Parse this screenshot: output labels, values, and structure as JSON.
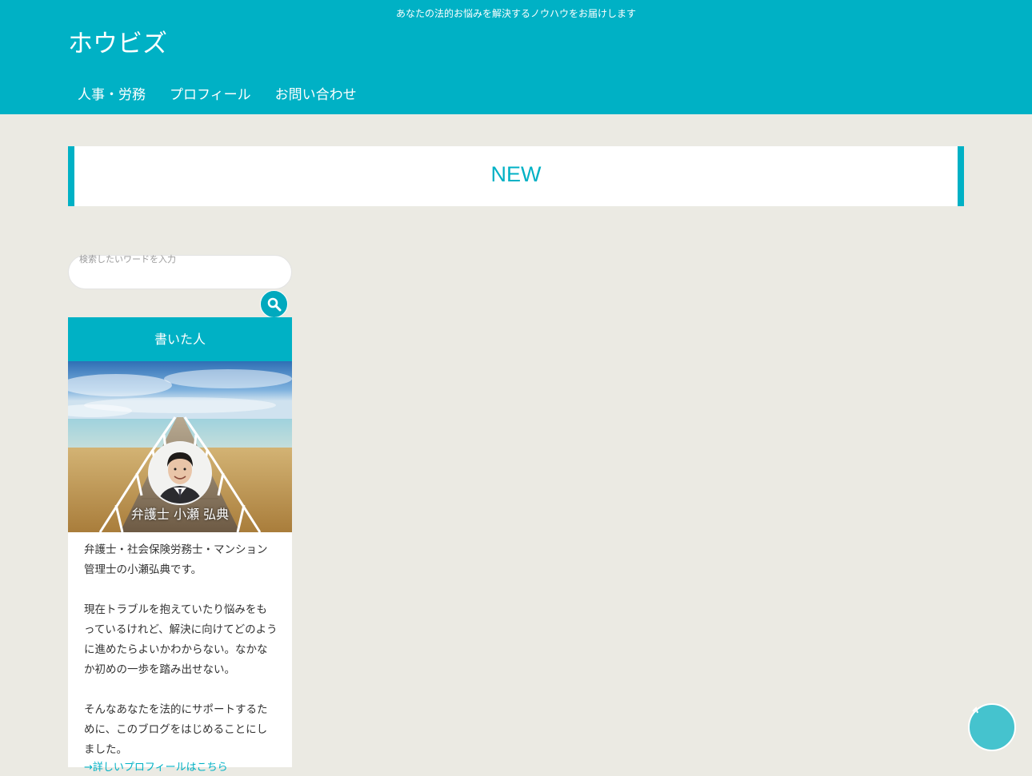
{
  "header": {
    "tagline": "あなたの法的お悩みを解決するノウハウをお届けします",
    "site_title": "ホウビズ",
    "nav": [
      {
        "label": "人事・労務"
      },
      {
        "label": "プロフィール"
      },
      {
        "label": "お問い合わせ"
      }
    ],
    "accent_color": "#00b1c5"
  },
  "main": {
    "section_title": "NEW"
  },
  "sidebar": {
    "search": {
      "placeholder": "検索したいワードを入力",
      "button_icon": "search-icon"
    },
    "author_widget": {
      "heading": "書いた人",
      "author_name": "弁護士 小瀬 弘典",
      "bio": [
        "弁護士・社会保険労務士・マンション管理士の小瀬弘典です。",
        "現在トラブルを抱えていたり悩みをもっているけれど、解決に向けてどのように進めたらよいかわからない。なかなか初めの一歩を踏み出せない。",
        "そんなあなたを法的にサポートするために、このブログをはじめることにしました。"
      ],
      "link_text": "→詳しいプロフィールはこちら"
    }
  },
  "scroll_top": {
    "icon": "chevron-up-icon"
  }
}
